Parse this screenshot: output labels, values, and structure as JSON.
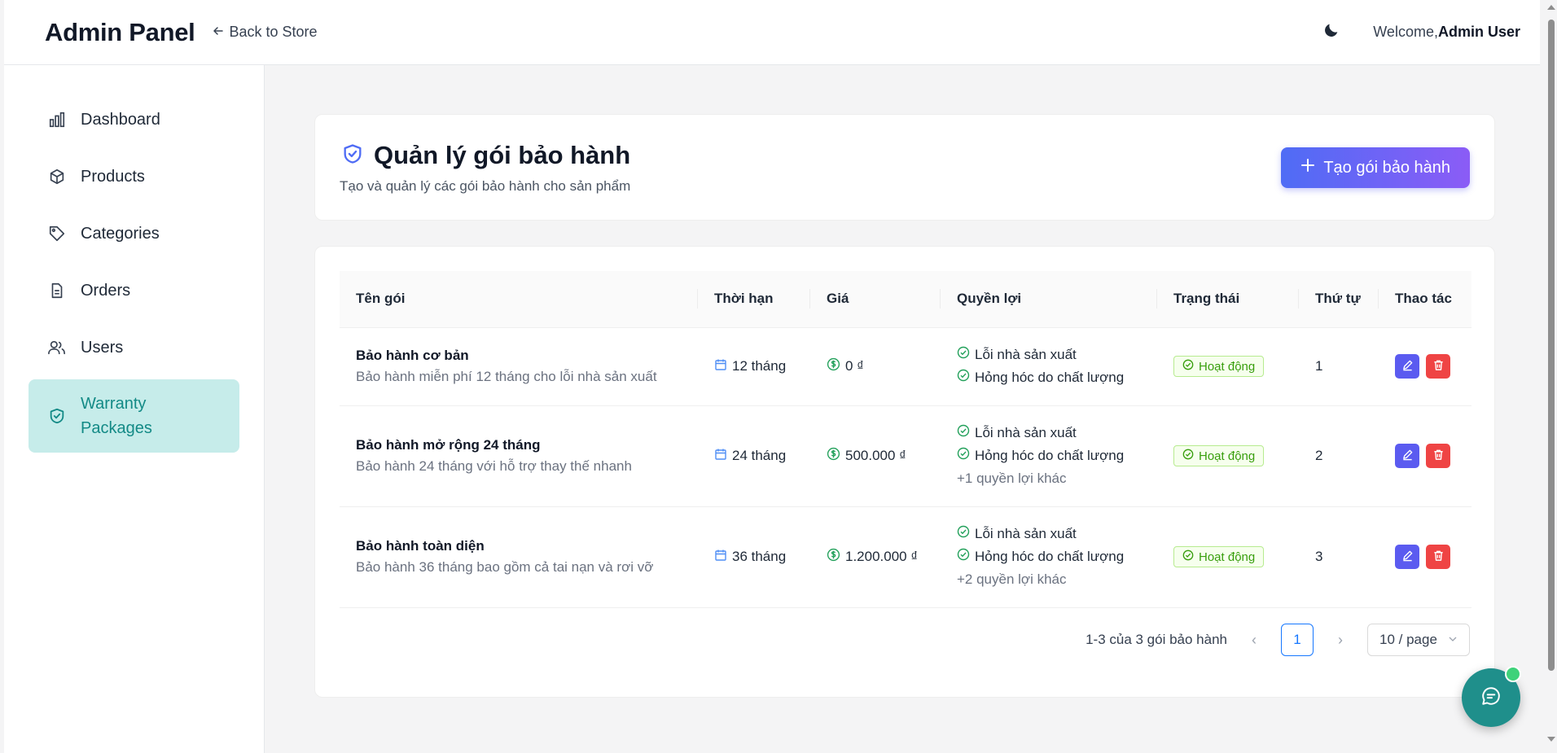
{
  "header": {
    "brand": "Admin Panel",
    "back_label": "Back to Store",
    "welcome_prefix": "Welcome,",
    "user_name": "Admin User",
    "theme_icon": "moon-icon"
  },
  "sidebar": {
    "items": [
      {
        "label": "Dashboard",
        "icon": "bar-chart-icon"
      },
      {
        "label": "Products",
        "icon": "box-icon"
      },
      {
        "label": "Categories",
        "icon": "tag-icon"
      },
      {
        "label": "Orders",
        "icon": "document-icon"
      },
      {
        "label": "Users",
        "icon": "users-icon"
      },
      {
        "label": "Warranty Packages",
        "icon": "shield-check-icon",
        "active": true
      }
    ]
  },
  "page": {
    "title": "Quản lý gói bảo hành",
    "subtitle": "Tạo và quản lý các gói bảo hành cho sản phẩm",
    "create_button": "Tạo gói bảo hành"
  },
  "table": {
    "columns": [
      "Tên gói",
      "Thời hạn",
      "Giá",
      "Quyền lợi",
      "Trạng thái",
      "Thứ tự",
      "Thao tác"
    ],
    "rows": [
      {
        "name": "Bảo hành cơ bản",
        "desc": "Bảo hành miễn phí 12 tháng cho lỗi nhà sản xuất",
        "duration": "12 tháng",
        "price": "0 ₫",
        "benefits": [
          "Lỗi nhà sản xuất",
          "Hỏng hóc do chất lượng"
        ],
        "more": "",
        "status": "Hoạt động",
        "order": "1"
      },
      {
        "name": "Bảo hành mở rộng 24 tháng",
        "desc": "Bảo hành 24 tháng với hỗ trợ thay thế nhanh",
        "duration": "24 tháng",
        "price": "500.000 ₫",
        "benefits": [
          "Lỗi nhà sản xuất",
          "Hỏng hóc do chất lượng"
        ],
        "more": "+1 quyền lợi khác",
        "status": "Hoạt động",
        "order": "2"
      },
      {
        "name": "Bảo hành toàn diện",
        "desc": "Bảo hành 36 tháng bao gồm cả tai nạn và rơi vỡ",
        "duration": "36 tháng",
        "price": "1.200.000 ₫",
        "benefits": [
          "Lỗi nhà sản xuất",
          "Hỏng hóc do chất lượng"
        ],
        "more": "+2 quyền lợi khác",
        "status": "Hoạt động",
        "order": "3"
      }
    ]
  },
  "pagination": {
    "summary": "1-3 của 3 gói bảo hành",
    "current_page": "1",
    "page_size": "10 / page"
  },
  "colors": {
    "accent": "#138a86",
    "active_bg": "#c6ecea",
    "primary_gradient_start": "#4f6cf5",
    "primary_gradient_end": "#8b5cf6",
    "status_green": "#389e0d",
    "delete_red": "#ef4444",
    "edit_indigo": "#5b5bf0"
  }
}
